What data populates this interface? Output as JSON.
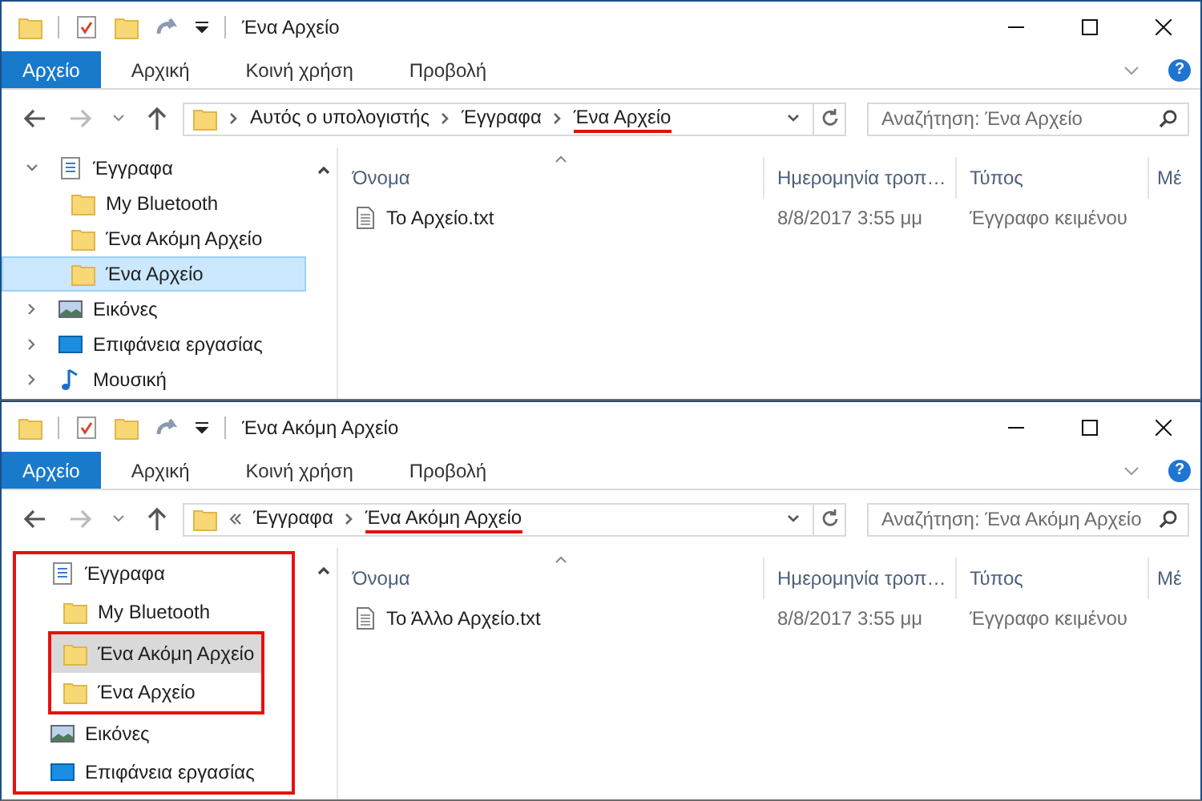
{
  "windows": [
    {
      "title": "Ένα Αρχείο",
      "active": true,
      "help": "?",
      "ribbon_tabs": [
        {
          "label": "Αρχείο",
          "selected": true
        },
        {
          "label": "Αρχική",
          "selected": false
        },
        {
          "label": "Κοινή χρήση",
          "selected": false
        },
        {
          "label": "Προβολή",
          "selected": false
        }
      ],
      "address": {
        "overflow": false,
        "segments": [
          {
            "label": "Αυτός ο υπολογιστής",
            "underlined": false
          },
          {
            "label": "Έγγραφα",
            "underlined": false
          },
          {
            "label": "Ένα Αρχείο",
            "underlined": true
          }
        ]
      },
      "search": {
        "placeholder": "Αναζήτηση: Ένα Αρχείο"
      },
      "nav": {
        "outlined": false,
        "show_chevrons": true,
        "items": [
          {
            "label": "Έγγραφα",
            "kind": "documents",
            "expanded": true,
            "selected": false,
            "children": [
              {
                "label": "My Bluetooth",
                "selected": false,
                "outlined": false
              },
              {
                "label": "Ένα Ακόμη Αρχείο",
                "selected": false,
                "outlined": false
              },
              {
                "label": "Ένα Αρχείο",
                "selected": true,
                "outlined": false
              }
            ]
          },
          {
            "label": "Εικόνες",
            "kind": "pictures",
            "expanded": false,
            "selected": false
          },
          {
            "label": "Επιφάνεια εργασίας",
            "kind": "desktop",
            "expanded": false,
            "selected": false
          },
          {
            "label": "Μουσική",
            "kind": "music",
            "expanded": false,
            "selected": false
          }
        ]
      },
      "columns": [
        "Όνομα",
        "Ημερομηνία τροπ…",
        "Τύπος",
        "Μέ"
      ],
      "files": [
        {
          "name": "Το Αρχείο.txt",
          "date": "8/8/2017 3:55 μμ",
          "type": "Έγγραφο κειμένου"
        }
      ]
    },
    {
      "title": "Ένα Ακόμη Αρχείο",
      "active": false,
      "help": "?",
      "ribbon_tabs": [
        {
          "label": "Αρχείο",
          "selected": true
        },
        {
          "label": "Αρχική",
          "selected": false
        },
        {
          "label": "Κοινή χρήση",
          "selected": false
        },
        {
          "label": "Προβολή",
          "selected": false
        }
      ],
      "address": {
        "overflow": true,
        "segments": [
          {
            "label": "Έγγραφα",
            "underlined": false
          },
          {
            "label": "Ένα Ακόμη Αρχείο",
            "underlined": true
          }
        ]
      },
      "search": {
        "placeholder": "Αναζήτηση: Ένα Ακόμη Αρχείο"
      },
      "nav": {
        "outlined": true,
        "show_chevrons": false,
        "items": [
          {
            "label": "Έγγραφα",
            "kind": "documents",
            "selected": false,
            "children": [
              {
                "label": "My Bluetooth",
                "selected": false,
                "outlined": false
              },
              {
                "label": "Ένα Ακόμη Αρχείο",
                "selected": true,
                "outlined": true
              },
              {
                "label": "Ένα Αρχείο",
                "selected": false,
                "outlined": true
              }
            ]
          },
          {
            "label": "Εικόνες",
            "kind": "pictures",
            "selected": false
          },
          {
            "label": "Επιφάνεια εργασίας",
            "kind": "desktop",
            "selected": false
          }
        ]
      },
      "columns": [
        "Όνομα",
        "Ημερομηνία τροπ…",
        "Τύπος",
        "Μέ"
      ],
      "files": [
        {
          "name": "Το Άλλο Αρχείο.txt",
          "date": "8/8/2017 3:55 μμ",
          "type": "Έγγραφο κειμένου"
        }
      ]
    }
  ]
}
